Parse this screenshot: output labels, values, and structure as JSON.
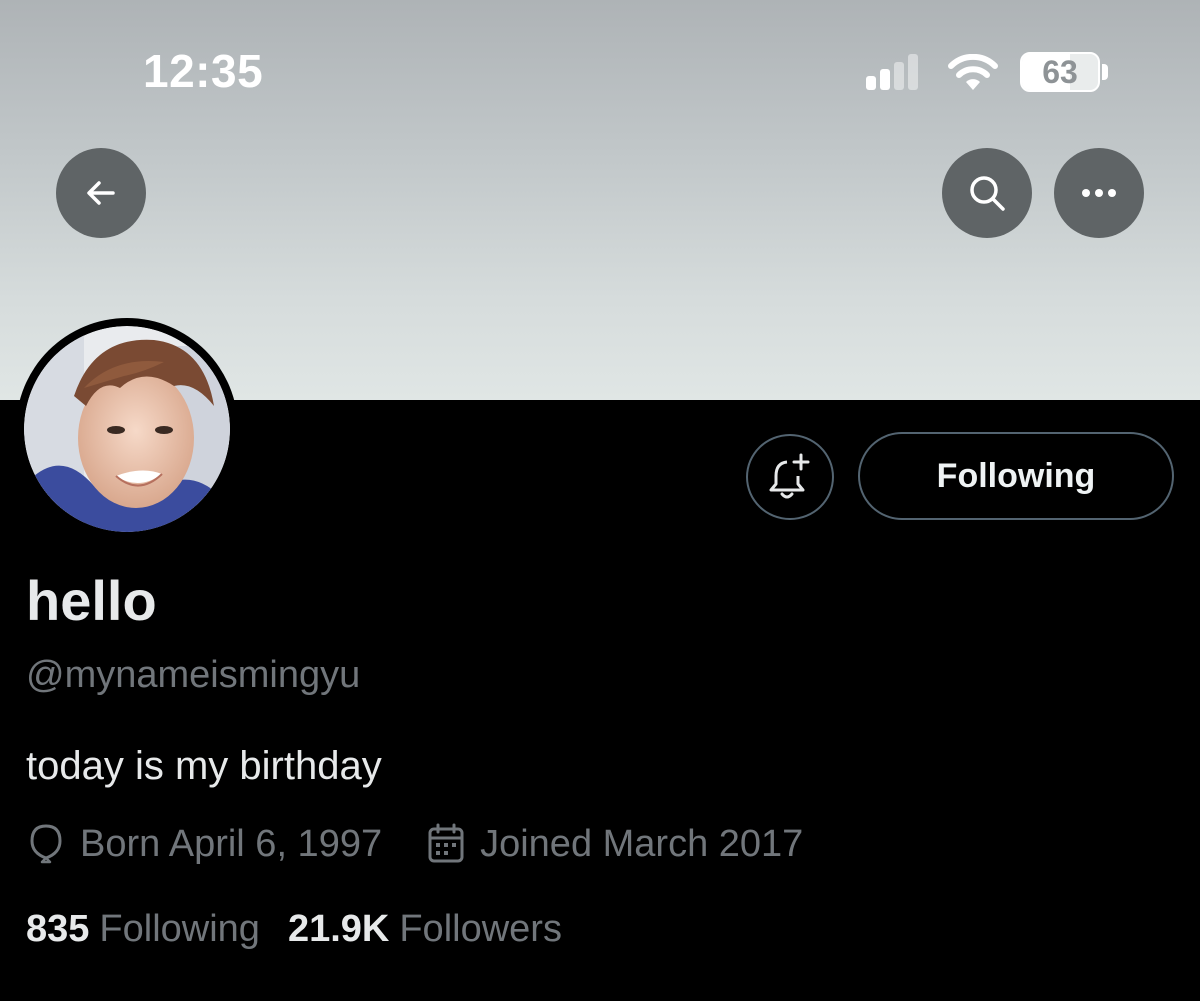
{
  "status_bar": {
    "time": "12:35",
    "battery_level": "63",
    "battery_fraction": 0.63,
    "signal_bars_filled": 2,
    "signal_bars_total": 4
  },
  "header": {
    "back_icon": "arrow-left-icon",
    "search_icon": "search-icon",
    "more_icon": "more-horizontal-icon"
  },
  "profile": {
    "display_name": "hello",
    "handle": "@mynameismingyu",
    "bio": "today is my birthday",
    "born_label": "Born April 6, 1997",
    "joined_label": "Joined March 2017",
    "following_count": "835",
    "following_label": "Following",
    "followers_count": "21.9K",
    "followers_label": "Followers"
  },
  "actions": {
    "follow_button_label": "Following",
    "notify_icon": "bell-plus-icon"
  },
  "colors": {
    "background": "#000000",
    "muted_text": "#71767b",
    "primary_text": "#e7e9ea",
    "button_border": "#536471",
    "header_button_bg": "#5f6466"
  }
}
